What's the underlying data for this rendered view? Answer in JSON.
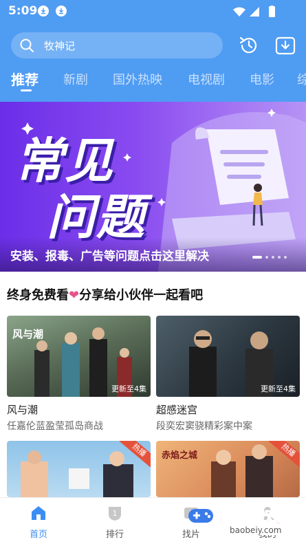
{
  "status_bar": {
    "time": "5:09"
  },
  "search": {
    "placeholder": "牧神记"
  },
  "tabs": [
    {
      "label": "推荐"
    },
    {
      "label": "新剧"
    },
    {
      "label": "国外热映"
    },
    {
      "label": "电视剧"
    },
    {
      "label": "电影"
    },
    {
      "label": "综"
    }
  ],
  "banner": {
    "line1": "常见",
    "line2": "问题",
    "caption": "安装、报毒、广告等问题点击这里解决",
    "slide_count": 5,
    "active_slide": 1
  },
  "section": {
    "title_part1": "终身免费看",
    "title_part2": "分享给小伙伴一起看吧"
  },
  "cards": [
    {
      "poster_title": "风与潮",
      "episode": "更新至4集",
      "name": "风与潮",
      "desc": "任嘉伦蓝盈莹孤岛商战",
      "badge": ""
    },
    {
      "poster_title": "",
      "episode": "更新至4集",
      "name": "超感迷宫",
      "desc": "段奕宏窦骁精彩案中案",
      "badge": ""
    },
    {
      "poster_title": "",
      "episode": "",
      "name": "",
      "desc": "",
      "badge": "热播"
    },
    {
      "poster_title": "赤焰之城",
      "episode": "",
      "name": "",
      "desc": "",
      "badge": "热播"
    }
  ],
  "nav": [
    {
      "label": "首页",
      "icon": "home-icon"
    },
    {
      "label": "排行",
      "icon": "rank-icon"
    },
    {
      "label": "找片",
      "icon": "find-icon"
    },
    {
      "label": "我的",
      "icon": "profile-icon"
    }
  ],
  "watermark": {
    "text": "宝贝游戏网",
    "url": "baobeiy.com"
  },
  "colors": {
    "header": "#4f9cf3",
    "accent": "#3b8ef5",
    "hot_badge": "#e5523b",
    "heart": "#e4548a"
  }
}
